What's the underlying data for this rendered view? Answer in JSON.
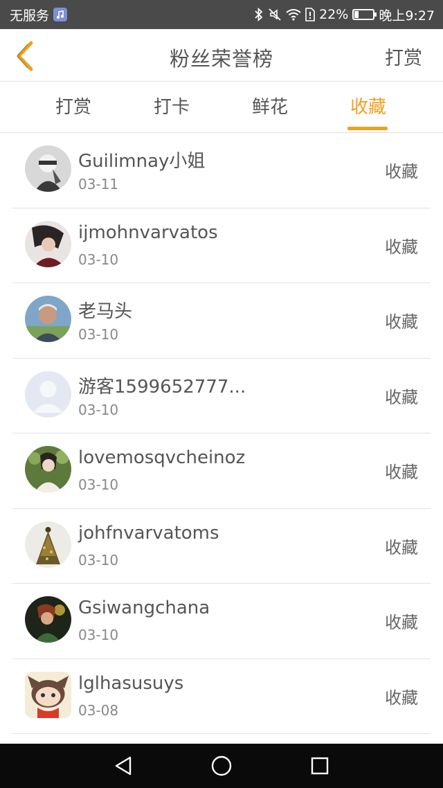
{
  "status_bar": {
    "carrier": "无服务",
    "battery_percent": "22%",
    "battery_level": 0.22,
    "time": "晚上9:27",
    "icons": [
      "music-icon",
      "bluetooth-icon",
      "mute-icon",
      "wifi-icon",
      "sim-alert-icon",
      "battery-icon"
    ]
  },
  "header": {
    "title": "粉丝荣誉榜",
    "action_label": "打赏",
    "back_icon": "chevron-left-icon"
  },
  "tabs": [
    {
      "label": "打赏",
      "active": false
    },
    {
      "label": "打卡",
      "active": false
    },
    {
      "label": "鲜花",
      "active": false
    },
    {
      "label": "收藏",
      "active": true
    }
  ],
  "list": [
    {
      "name": "Guilimnay小姐",
      "date": "03-11",
      "action": "收藏",
      "avatar": "photo"
    },
    {
      "name": "ijmohnvarvatos",
      "date": "03-10",
      "action": "收藏",
      "avatar": "photo"
    },
    {
      "name": "老马头",
      "date": "03-10",
      "action": "收藏",
      "avatar": "photo"
    },
    {
      "name": "游客1599652777...",
      "date": "03-10",
      "action": "收藏",
      "avatar": "default-user-icon"
    },
    {
      "name": "lovemosqvcheinoz",
      "date": "03-10",
      "action": "收藏",
      "avatar": "photo"
    },
    {
      "name": "johfnvarvatoms",
      "date": "03-10",
      "action": "收藏",
      "avatar": "photo"
    },
    {
      "name": "Gsiwangchana",
      "date": "03-10",
      "action": "收藏",
      "avatar": "photo"
    },
    {
      "name": "lglhasusuys",
      "date": "03-08",
      "action": "收藏",
      "avatar": "photo"
    }
  ],
  "nav_bar": {
    "icons": [
      "back-triangle-icon",
      "home-circle-icon",
      "recents-square-icon"
    ]
  },
  "colors": {
    "accent": "#f0a020",
    "status_bar_bg": "#4a4a4a",
    "text": "#555555",
    "nav_bar_bg": "#0a0a0a"
  }
}
